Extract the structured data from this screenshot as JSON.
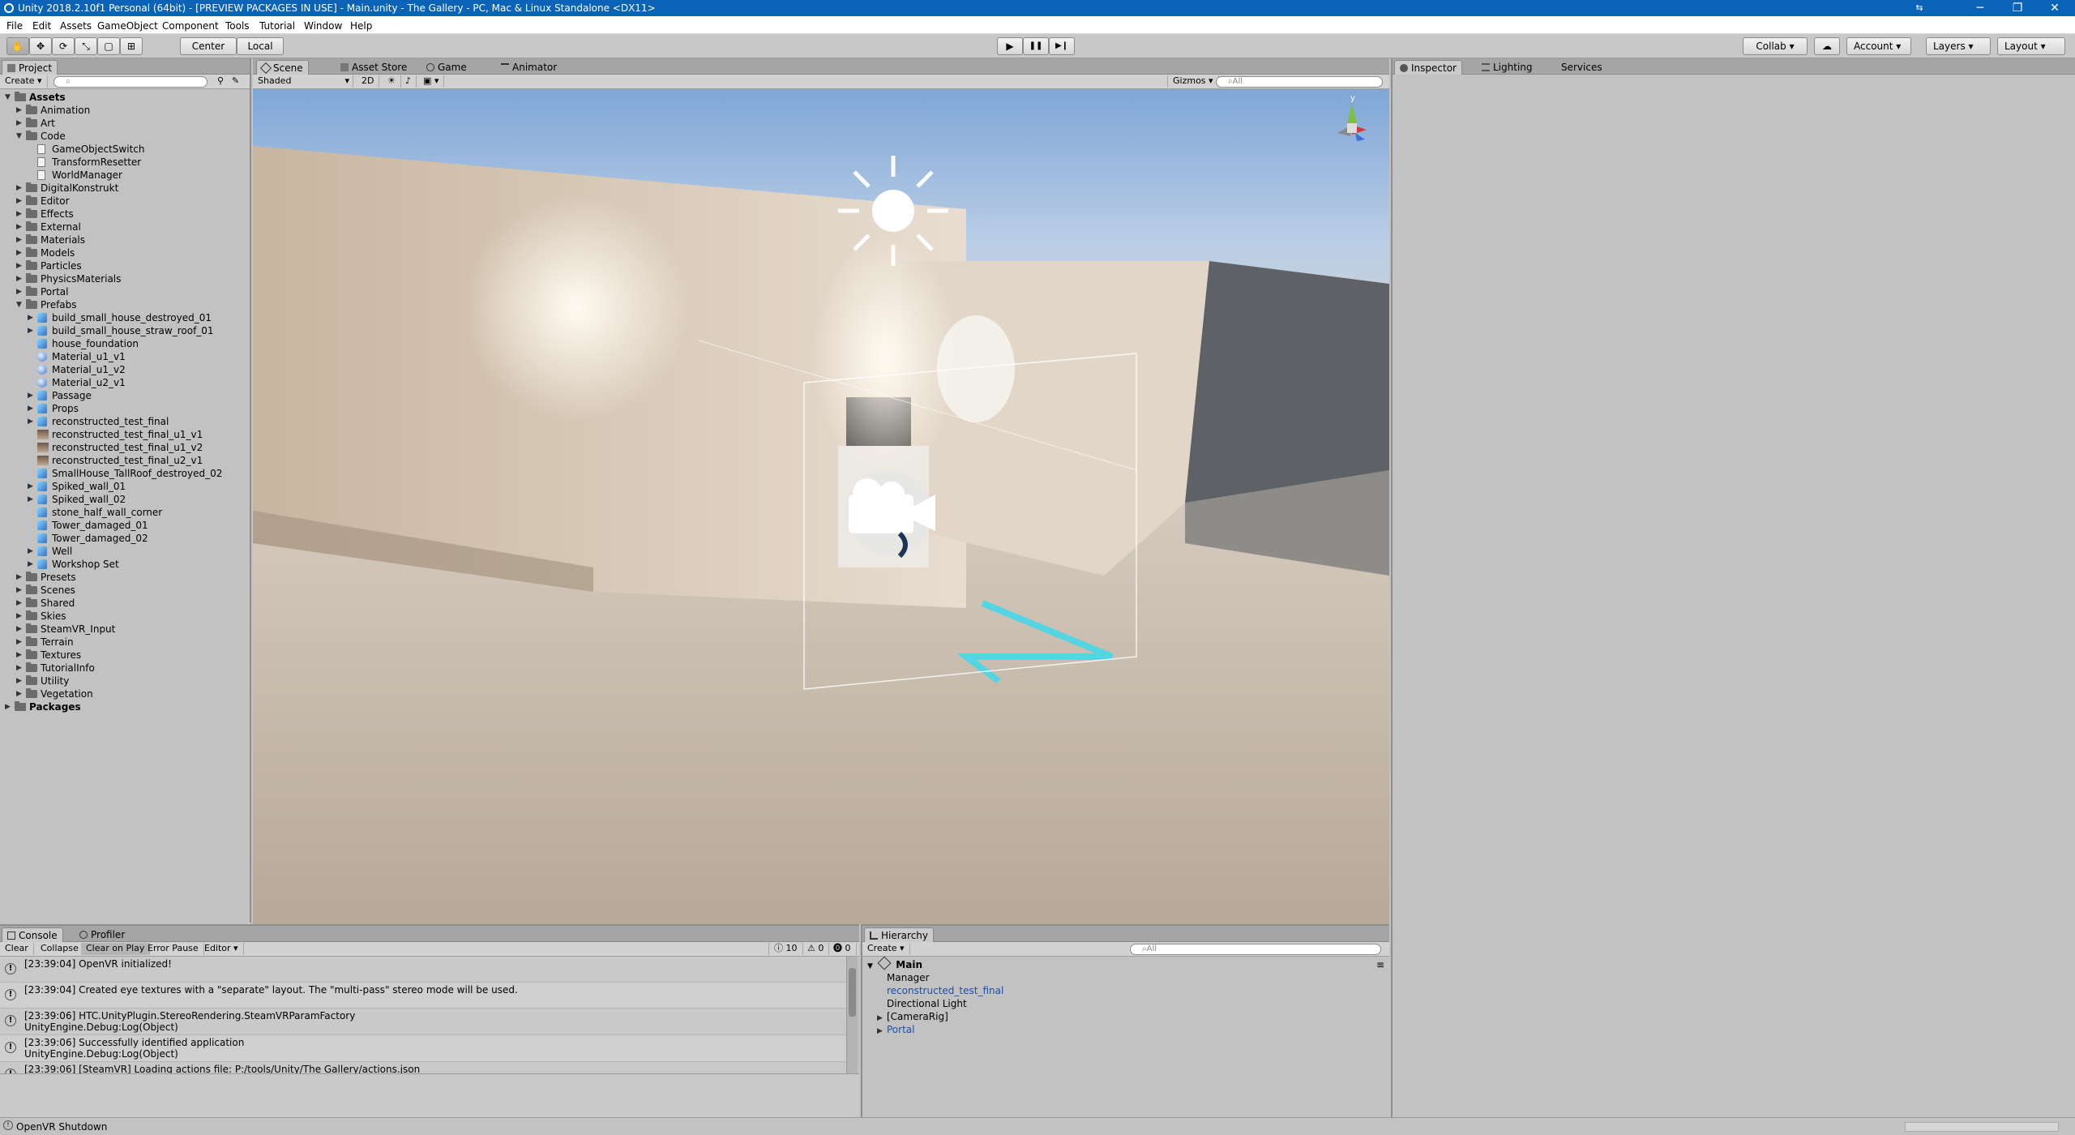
{
  "window": {
    "title": "Unity 2018.2.10f1 Personal (64bit) - [PREVIEW PACKAGES IN USE] - Main.unity - The Gallery - PC, Mac & Linux Standalone <DX11>",
    "minimize": "─",
    "restore": "❐",
    "close": "✕"
  },
  "menu": [
    "File",
    "Edit",
    "Assets",
    "GameObject",
    "Component",
    "Tools",
    "Tutorial",
    "Window",
    "Help"
  ],
  "toolbar": {
    "pivot_center": "Center",
    "pivot_local": "Local",
    "play": "▶",
    "pause": "❚❚",
    "step": "▶❙",
    "collab": "Collab ▾",
    "account": "Account",
    "layers": "Layers",
    "layout": "Layout"
  },
  "project": {
    "tab": "Project",
    "create": "Create",
    "items": [
      {
        "label": "Assets",
        "depth": 0,
        "kind": "folder",
        "arrow": "▼",
        "bold": true
      },
      {
        "label": "Animation",
        "depth": 1,
        "kind": "folder",
        "arrow": "▶"
      },
      {
        "label": "Art",
        "depth": 1,
        "kind": "folder",
        "arrow": "▶"
      },
      {
        "label": "Code",
        "depth": 1,
        "kind": "folder",
        "arrow": "▼"
      },
      {
        "label": "GameObjectSwitch",
        "depth": 2,
        "kind": "script",
        "arrow": ""
      },
      {
        "label": "TransformResetter",
        "depth": 2,
        "kind": "script",
        "arrow": ""
      },
      {
        "label": "WorldManager",
        "depth": 2,
        "kind": "script",
        "arrow": ""
      },
      {
        "label": "DigitalKonstrukt",
        "depth": 1,
        "kind": "folder",
        "arrow": "▶"
      },
      {
        "label": "Editor",
        "depth": 1,
        "kind": "folder",
        "arrow": "▶"
      },
      {
        "label": "Effects",
        "depth": 1,
        "kind": "folder",
        "arrow": "▶"
      },
      {
        "label": "External",
        "depth": 1,
        "kind": "folder",
        "arrow": "▶"
      },
      {
        "label": "Materials",
        "depth": 1,
        "kind": "folder",
        "arrow": "▶"
      },
      {
        "label": "Models",
        "depth": 1,
        "kind": "folder",
        "arrow": "▶"
      },
      {
        "label": "Particles",
        "depth": 1,
        "kind": "folder",
        "arrow": "▶"
      },
      {
        "label": "PhysicsMaterials",
        "depth": 1,
        "kind": "folder",
        "arrow": "▶"
      },
      {
        "label": "Portal",
        "depth": 1,
        "kind": "folder",
        "arrow": "▶"
      },
      {
        "label": "Prefabs",
        "depth": 1,
        "kind": "folder",
        "arrow": "▼"
      },
      {
        "label": "build_small_house_destroyed_01",
        "depth": 2,
        "kind": "cube",
        "arrow": "▶"
      },
      {
        "label": "build_small_house_straw_roof_01",
        "depth": 2,
        "kind": "cube",
        "arrow": "▶"
      },
      {
        "label": "house_foundation",
        "depth": 2,
        "kind": "cube",
        "arrow": ""
      },
      {
        "label": "Material_u1_v1",
        "depth": 2,
        "kind": "sphere",
        "arrow": ""
      },
      {
        "label": "Material_u1_v2",
        "depth": 2,
        "kind": "sphere",
        "arrow": ""
      },
      {
        "label": "Material_u2_v1",
        "depth": 2,
        "kind": "sphere",
        "arrow": ""
      },
      {
        "label": "Passage",
        "depth": 2,
        "kind": "cube",
        "arrow": "▶"
      },
      {
        "label": "Props",
        "depth": 2,
        "kind": "cube",
        "arrow": "▶"
      },
      {
        "label": "reconstructed_test_final",
        "depth": 2,
        "kind": "cube",
        "arrow": "▶"
      },
      {
        "label": "reconstructed_test_final_u1_v1",
        "depth": 2,
        "kind": "thumb",
        "arrow": ""
      },
      {
        "label": "reconstructed_test_final_u1_v2",
        "depth": 2,
        "kind": "thumb",
        "arrow": ""
      },
      {
        "label": "reconstructed_test_final_u2_v1",
        "depth": 2,
        "kind": "thumb",
        "arrow": ""
      },
      {
        "label": "SmallHouse_TallRoof_destroyed_02",
        "depth": 2,
        "kind": "cube",
        "arrow": ""
      },
      {
        "label": "Spiked_wall_01",
        "depth": 2,
        "kind": "cube",
        "arrow": "▶"
      },
      {
        "label": "Spiked_wall_02",
        "depth": 2,
        "kind": "cube",
        "arrow": "▶"
      },
      {
        "label": "stone_half_wall_corner",
        "depth": 2,
        "kind": "cube",
        "arrow": ""
      },
      {
        "label": "Tower_damaged_01",
        "depth": 2,
        "kind": "cube",
        "arrow": ""
      },
      {
        "label": "Tower_damaged_02",
        "depth": 2,
        "kind": "cube",
        "arrow": ""
      },
      {
        "label": "Well",
        "depth": 2,
        "kind": "cube",
        "arrow": "▶"
      },
      {
        "label": "Workshop Set",
        "depth": 2,
        "kind": "cube",
        "arrow": "▶"
      },
      {
        "label": "Presets",
        "depth": 1,
        "kind": "folder",
        "arrow": "▶"
      },
      {
        "label": "Scenes",
        "depth": 1,
        "kind": "folder",
        "arrow": "▶"
      },
      {
        "label": "Shared",
        "depth": 1,
        "kind": "folder",
        "arrow": "▶"
      },
      {
        "label": "Skies",
        "depth": 1,
        "kind": "folder",
        "arrow": "▶"
      },
      {
        "label": "SteamVR_Input",
        "depth": 1,
        "kind": "folder",
        "arrow": "▶"
      },
      {
        "label": "Terrain",
        "depth": 1,
        "kind": "folder",
        "arrow": "▶"
      },
      {
        "label": "Textures",
        "depth": 1,
        "kind": "folder",
        "arrow": "▶"
      },
      {
        "label": "TutorialInfo",
        "depth": 1,
        "kind": "folder",
        "arrow": "▶"
      },
      {
        "label": "Utility",
        "depth": 1,
        "kind": "folder",
        "arrow": "▶"
      },
      {
        "label": "Vegetation",
        "depth": 1,
        "kind": "folder",
        "arrow": "▶"
      },
      {
        "label": "Packages",
        "depth": 0,
        "kind": "folder",
        "arrow": "▶",
        "bold": true
      }
    ]
  },
  "scene": {
    "tabs": [
      "Scene",
      "Asset Store",
      "Game",
      "Animator"
    ],
    "shading": "Shaded",
    "mode_2d": "2D",
    "gizmos": "Gizmos",
    "search_placeholder": "All",
    "axis_y": "y"
  },
  "inspector": {
    "tabs": [
      "Inspector",
      "Lighting",
      "Services"
    ]
  },
  "console": {
    "tabs": [
      "Console",
      "Profiler"
    ],
    "buttons": [
      "Clear",
      "Collapse",
      "Clear on Play",
      "Error Pause",
      "Editor"
    ],
    "counts": {
      "info": "10",
      "warn": "0",
      "error": "0"
    },
    "entries": [
      {
        "line1": "[23:39:04] OpenVR initialized!",
        "line2": ""
      },
      {
        "line1": "[23:39:04] Created eye textures with a \"separate\" layout.  The \"multi-pass\" stereo mode will be used.",
        "line2": ""
      },
      {
        "line1": "[23:39:06] HTC.UnityPlugin.StereoRendering.SteamVRParamFactory",
        "line2": "UnityEngine.Debug:Log(Object)"
      },
      {
        "line1": "[23:39:06] Successfully identified application",
        "line2": "UnityEngine.Debug:Log(Object)"
      },
      {
        "line1": "[23:39:06] [SteamVR] Loading actions file: P:/tools/Unity/The Gallery/actions.json",
        "line2": ""
      }
    ]
  },
  "hierarchy": {
    "tab": "Hierarchy",
    "create": "Create",
    "search_placeholder": "All",
    "scene_name": "Main",
    "items": [
      {
        "label": "Manager",
        "color": "black",
        "arrow": ""
      },
      {
        "label": "reconstructed_test_final",
        "color": "blue",
        "arrow": ""
      },
      {
        "label": "Directional Light",
        "color": "black",
        "arrow": ""
      },
      {
        "label": "[CameraRig]",
        "color": "black",
        "arrow": "▶"
      },
      {
        "label": "Portal",
        "color": "blue",
        "arrow": "▶"
      }
    ]
  },
  "status": {
    "text": "OpenVR Shutdown"
  }
}
